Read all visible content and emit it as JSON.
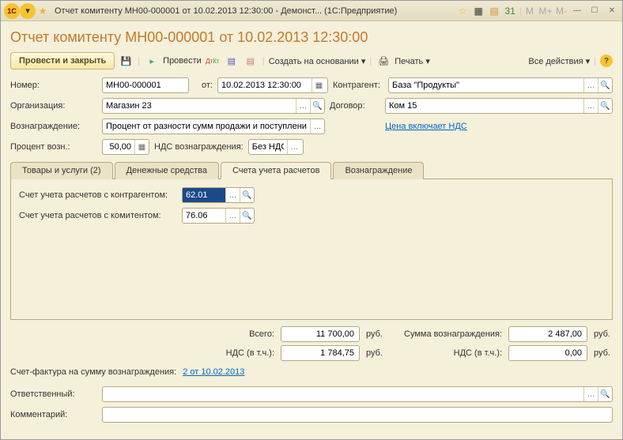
{
  "titlebar": {
    "text": "Отчет комитенту МН00-000001 от 10.02.2013 12:30:00 - Демонст...   (1С:Предприятие)",
    "markers": [
      "M",
      "M+",
      "M-"
    ]
  },
  "page_title": "Отчет комитенту МН00-000001 от 10.02.2013 12:30:00",
  "toolbar": {
    "save_close": "Провести и закрыть",
    "post": "Провести",
    "create_based": "Создать на основании",
    "print": "Печать",
    "all_actions": "Все действия"
  },
  "fields": {
    "number_label": "Номер:",
    "number_value": "МН00-000001",
    "date_label": "от:",
    "date_value": "10.02.2013 12:30:00",
    "counterparty_label": "Контрагент:",
    "counterparty_value": "База \"Продукты\"",
    "org_label": "Организация:",
    "org_value": "Магазин 23",
    "contract_label": "Договор:",
    "contract_value": "Ком 15",
    "reward_label": "Вознаграждение:",
    "reward_value": "Процент от разности сумм продажи и поступлени",
    "price_link": "Цена включает НДС",
    "percent_label": "Процент возн.:",
    "percent_value": "50,00",
    "vat_reward_label": "НДС вознаграждения:",
    "vat_reward_value": "Без НДС"
  },
  "tabs": [
    "Товары и услуги (2)",
    "Денежные средства",
    "Счета учета расчетов",
    "Вознаграждение"
  ],
  "tab_content": {
    "acc1_label": "Счет учета расчетов с контрагентом:",
    "acc1_value": "62.01",
    "acc2_label": "Счет учета расчетов с комитентом:",
    "acc2_value": "76.06"
  },
  "totals": {
    "total_label": "Всего:",
    "total_value": "11 700,00",
    "vat_label": "НДС (в т.ч.):",
    "vat_value": "1 784,75",
    "reward_sum_label": "Сумма вознаграждения:",
    "reward_sum_value": "2 487,00",
    "reward_vat_label": "НДС (в т.ч.):",
    "reward_vat_value": "0,00",
    "unit": "руб."
  },
  "invoice": {
    "label": "Счет-фактура на сумму вознаграждения:",
    "link": "2 от 10.02.2013"
  },
  "footer": {
    "responsible_label": "Ответственный:",
    "comment_label": "Комментарий:"
  }
}
